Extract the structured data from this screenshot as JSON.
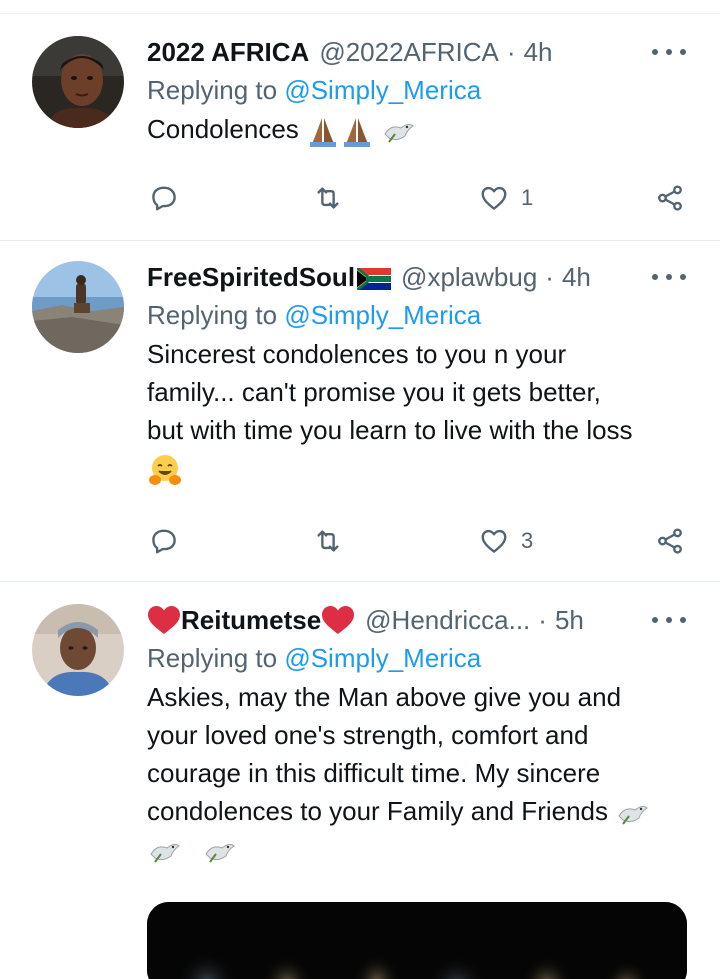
{
  "tweets": [
    {
      "display_name": "2022 AFRICA",
      "handle": "@2022AFRICA",
      "separator": "·",
      "time": "4h",
      "replying_prefix": "Replying to",
      "replying_mention": "@Simply_Merica",
      "text": "Condolences",
      "emoji_after_text": [
        "folded-hands-medium-dark",
        "folded-hands-medium-dark",
        "dove"
      ],
      "actions": {
        "reply_count": "",
        "retweet_count": "",
        "like_count": "1"
      }
    },
    {
      "display_name": "FreeSpiritedSoul",
      "name_flag": "south-africa-flag",
      "handle": "@xplawbug",
      "separator": "·",
      "time": "4h",
      "replying_prefix": "Replying to",
      "replying_mention": "@Simply_Merica",
      "text_lines": [
        "Sincerest condolences to you n your",
        "family... can't promise you it gets better,",
        "but with time you learn to live with the loss"
      ],
      "emoji_after_text": [
        "hugging-face"
      ],
      "actions": {
        "reply_count": "",
        "retweet_count": "",
        "like_count": "3"
      }
    },
    {
      "display_name": "Reitumetse",
      "name_decoration": "red-heart",
      "handle": "@Hendricca...",
      "separator": "·",
      "time": "5h",
      "replying_prefix": "Replying to",
      "replying_mention": "@Simply_Merica",
      "text_lines": [
        "Askies, may the Man above give you and",
        "your loved one's strength, comfort and",
        "courage in this difficult time. My sincere",
        "condolences to your Family and Friends"
      ],
      "emoji_after_text": [
        "dove",
        "dove",
        "dove"
      ],
      "has_media": true
    }
  ],
  "icons": {
    "reply": "reply-icon",
    "retweet": "retweet-icon",
    "like": "heart-icon",
    "share": "share-icon",
    "more": "more-icon"
  },
  "colors": {
    "text_primary": "#0f1419",
    "text_secondary": "#536471",
    "mention": "#1d9bf0",
    "divider": "#e6ecf0"
  }
}
